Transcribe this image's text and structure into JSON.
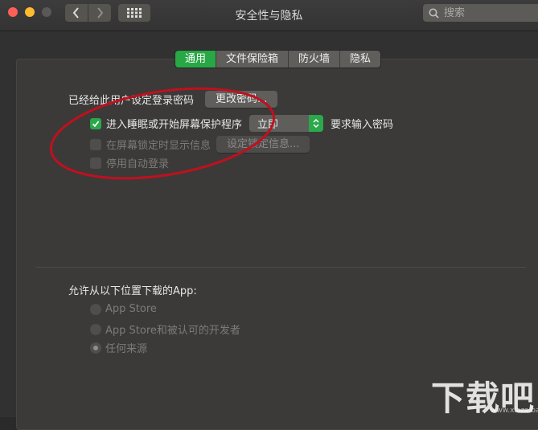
{
  "window": {
    "title": "安全性与隐私"
  },
  "search": {
    "placeholder": "搜索"
  },
  "tabs": [
    {
      "label": "通用",
      "active": true
    },
    {
      "label": "文件保险箱",
      "active": false
    },
    {
      "label": "防火墙",
      "active": false
    },
    {
      "label": "隐私",
      "active": false
    }
  ],
  "general": {
    "password_label": "已经给此用户设定登录密码",
    "change_password_button": "更改密码...",
    "sleep_checkbox": {
      "label": "进入睡眠或开始屏幕保护程序",
      "checked": true
    },
    "sleep_select_value": "立即",
    "require_password_label": "要求输入密码",
    "lock_message_checkbox": {
      "label": "在屏幕锁定时显示信息",
      "checked": false,
      "disabled": true
    },
    "set_lock_message_button": "设定锁定信息...",
    "disable_autologin_checkbox": {
      "label": "停用自动登录",
      "checked": false,
      "disabled": true
    }
  },
  "downloads": {
    "label": "允许从以下位置下载的App:",
    "options": [
      {
        "label": "App Store",
        "selected": false
      },
      {
        "label": "App Store和被认可的开发者",
        "selected": false
      },
      {
        "label": "任何来源",
        "selected": true
      }
    ]
  },
  "watermark": {
    "text": "下载吧",
    "url": "www.xiazaiba.com"
  },
  "colors": {
    "accent": "#28a745",
    "annotation": "#c0101e",
    "background": "#323131"
  }
}
